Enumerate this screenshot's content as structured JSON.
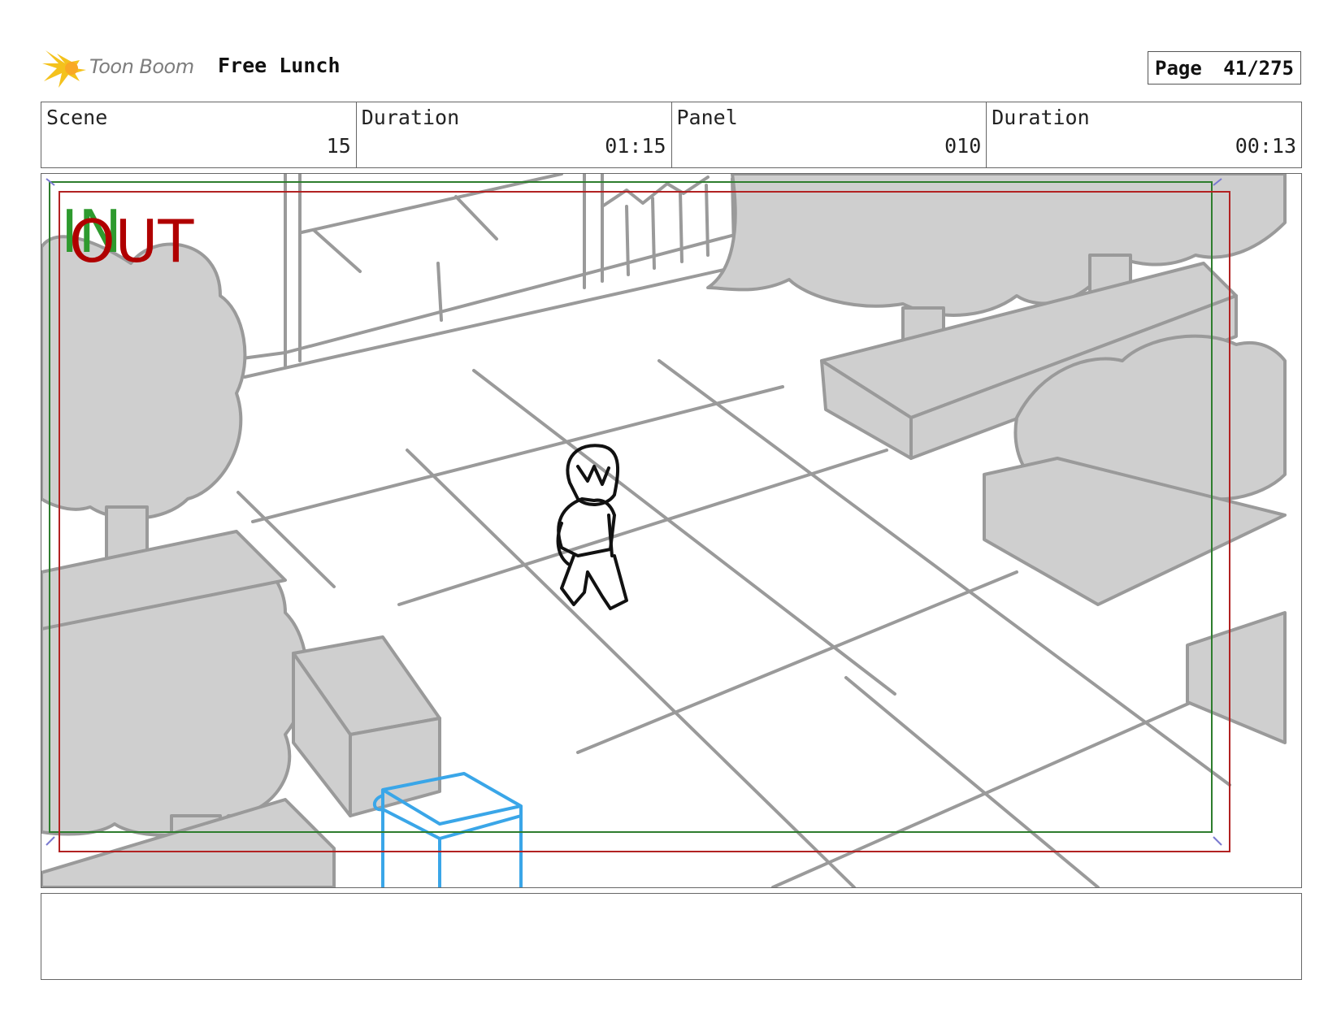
{
  "header": {
    "brand": "Toon Boom",
    "project_title": "Free Lunch",
    "page_label": "Page",
    "page_number": "41/275"
  },
  "info": {
    "scene_label": "Scene",
    "scene_value": "15",
    "scene_duration_label": "Duration",
    "scene_duration_value": "01:15",
    "panel_label": "Panel",
    "panel_value": "010",
    "panel_duration_label": "Duration",
    "panel_duration_value": "00:13"
  },
  "panel": {
    "in_label": "IN",
    "out_label": "OUT"
  },
  "notes": {
    "text": ""
  },
  "colors": {
    "in_green": "#2e9a2e",
    "out_red": "#b00000",
    "sketch_gray": "#9a9a9a",
    "fill_gray": "#cfcfcf",
    "cart_blue": "#3aa6e8"
  }
}
